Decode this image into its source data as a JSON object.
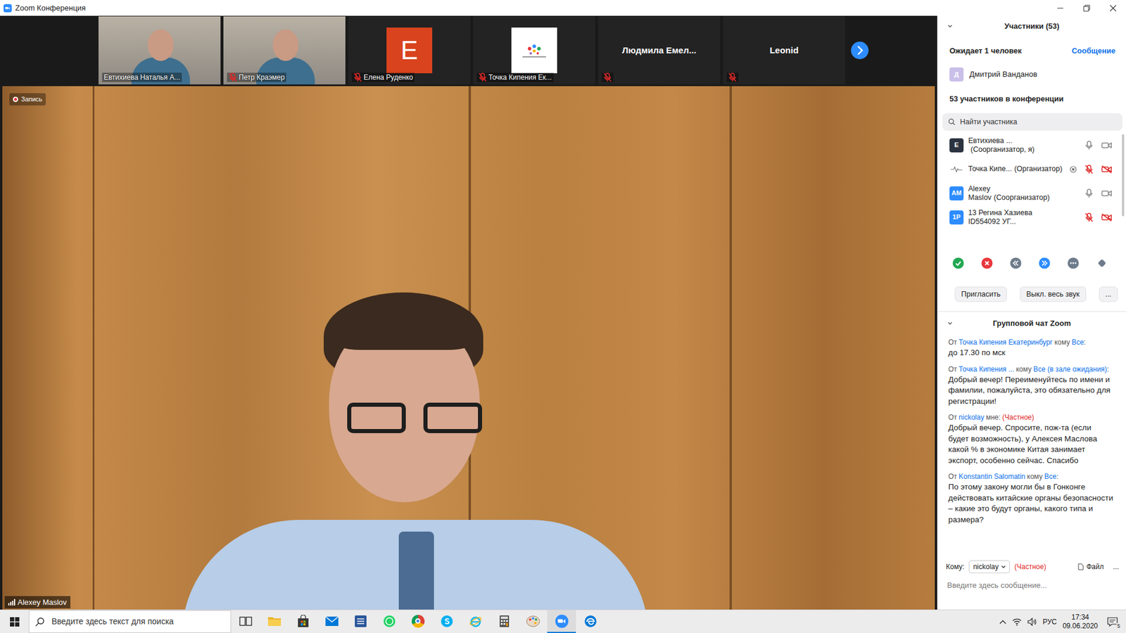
{
  "window": {
    "title": "Zoom Конференция"
  },
  "thumbnails": [
    {
      "name": "Евтихиева Наталья А...",
      "kind": "video",
      "muted": false
    },
    {
      "name": "Петр Краэмер",
      "kind": "video",
      "muted": true
    },
    {
      "name": "Елена Руденко",
      "kind": "avatar",
      "letter": "E",
      "color": "#d9431e",
      "muted": true
    },
    {
      "name": "Точка Кипения Ек...",
      "kind": "logo",
      "muted": true
    },
    {
      "name": "Людмила Емел...",
      "kind": "name",
      "muted": true
    },
    {
      "name": "Leonid",
      "kind": "name",
      "muted": true
    }
  ],
  "recording": {
    "label": "Запись",
    "on": true
  },
  "speaker": {
    "name": "Alexey Maslov"
  },
  "participants_panel": {
    "title": "Участники (53)",
    "waiting_label": "Ожидает 1 человек",
    "message_action": "Сообщение",
    "waiting": [
      {
        "avatar": "Д",
        "name": "Дмитрий Ванданов",
        "color": "#c9bfe8"
      }
    ],
    "count_label": "53 участников в конференции",
    "search_placeholder": "Найти участника",
    "participants": [
      {
        "kind": "letter",
        "avatar": "E",
        "name": "Евтихиева ...",
        "role": "(Соорганизатор, я)",
        "recording": false,
        "mic_muted": false,
        "video_off": false,
        "color": "#2b3440"
      },
      {
        "kind": "logo",
        "name": "Точка Кипе...",
        "role": "(Организатор)",
        "recording": true,
        "mic_muted": true,
        "video_off": true,
        "color": "#ffffff"
      },
      {
        "kind": "letter",
        "avatar": "AM",
        "name": "Alexey Maslov",
        "role": "(Соорганизатор)",
        "recording": false,
        "mic_muted": false,
        "video_off": false,
        "color": "#2d8cff"
      },
      {
        "kind": "letter",
        "avatar": "1Р",
        "name": "13 Регина Хазиева ID554092 УГ...",
        "recording": false,
        "mic_muted": true,
        "video_off": true,
        "color": "#2d8cff"
      }
    ],
    "reactions": [
      {
        "kind": "yes",
        "color": "#22a853"
      },
      {
        "kind": "no",
        "color": "#e8383d"
      },
      {
        "kind": "slower",
        "color": "#6e7b8b"
      },
      {
        "kind": "faster",
        "color": "#2d8cff"
      },
      {
        "kind": "more",
        "color": "#6e7b8b"
      },
      {
        "kind": "clear",
        "color": "#6e7b8b"
      }
    ],
    "buttons": [
      "Пригласить",
      "Выкл. весь звук",
      "..."
    ]
  },
  "chat": {
    "title": "Групповой чат Zoom",
    "messages": [
      {
        "header": [
          {
            "text": "От",
            "kind": "plain"
          },
          {
            "text": "Точка Кипения Екатеринбург",
            "kind": "name"
          },
          {
            "text": "кому",
            "kind": "plain"
          },
          {
            "text": "Все",
            "kind": "name"
          },
          {
            "text": ":",
            "kind": "punct"
          }
        ],
        "text": "до 17.30 по мск"
      },
      {
        "header": [
          {
            "text": "От",
            "kind": "plain"
          },
          {
            "text": "Точка Кипения ...",
            "kind": "name"
          },
          {
            "text": "кому",
            "kind": "plain"
          },
          {
            "text": "Все (в зале ожидания)",
            "kind": "name"
          },
          {
            "text": ":",
            "kind": "punct"
          }
        ],
        "text": "Добрый вечер! Переименуйтесь по имени и фамилии, пожалуйста, это обязательно для регистрации!"
      },
      {
        "header": [
          {
            "text": "От",
            "kind": "plain"
          },
          {
            "text": "nickolay",
            "kind": "name"
          },
          {
            "text": "мне:",
            "kind": "plain"
          },
          {
            "text": "(Частное)",
            "kind": "private"
          }
        ],
        "text": "Добрый вечер. Спросите, пож-та (если будет возможность), у Алексея Маслова какой % в экономике Китая занимает экспорт, особенно сейчас. Спасибо"
      },
      {
        "header": [
          {
            "text": "От",
            "kind": "plain"
          },
          {
            "text": "Konstantin Salomatin",
            "kind": "name"
          },
          {
            "text": "кому",
            "kind": "plain"
          },
          {
            "text": "Все",
            "kind": "name"
          },
          {
            "text": ":",
            "kind": "punct"
          }
        ],
        "text": "По этому закону могли бы в Гонконге действовать китайские органы безопасности – какие это будут органы, какого типа и размера?"
      }
    ],
    "to_label": "Кому:",
    "recipient": "nickolay",
    "private_label": "(Частное)",
    "file_label": "Файл",
    "more": "...",
    "input_placeholder": "Введите здесь сообщение..."
  },
  "taskbar": {
    "search_placeholder": "Введите здесь текст для поиска",
    "apps": [
      {
        "kind": "task-view",
        "selected": false
      },
      {
        "kind": "explorer",
        "selected": false
      },
      {
        "kind": "store",
        "selected": false
      },
      {
        "kind": "mail",
        "selected": false
      },
      {
        "kind": "word",
        "selected": false
      },
      {
        "kind": "whatsapp",
        "selected": false
      },
      {
        "kind": "chrome",
        "selected": false
      },
      {
        "kind": "skype",
        "selected": false
      },
      {
        "kind": "ie",
        "selected": false
      },
      {
        "kind": "calculator",
        "selected": false
      },
      {
        "kind": "paint",
        "selected": false
      },
      {
        "kind": "zoom",
        "selected": true
      },
      {
        "kind": "edge",
        "selected": false
      }
    ],
    "language": "РУС",
    "time": "17:34",
    "date": "09.06.2020",
    "notifications": "5"
  }
}
